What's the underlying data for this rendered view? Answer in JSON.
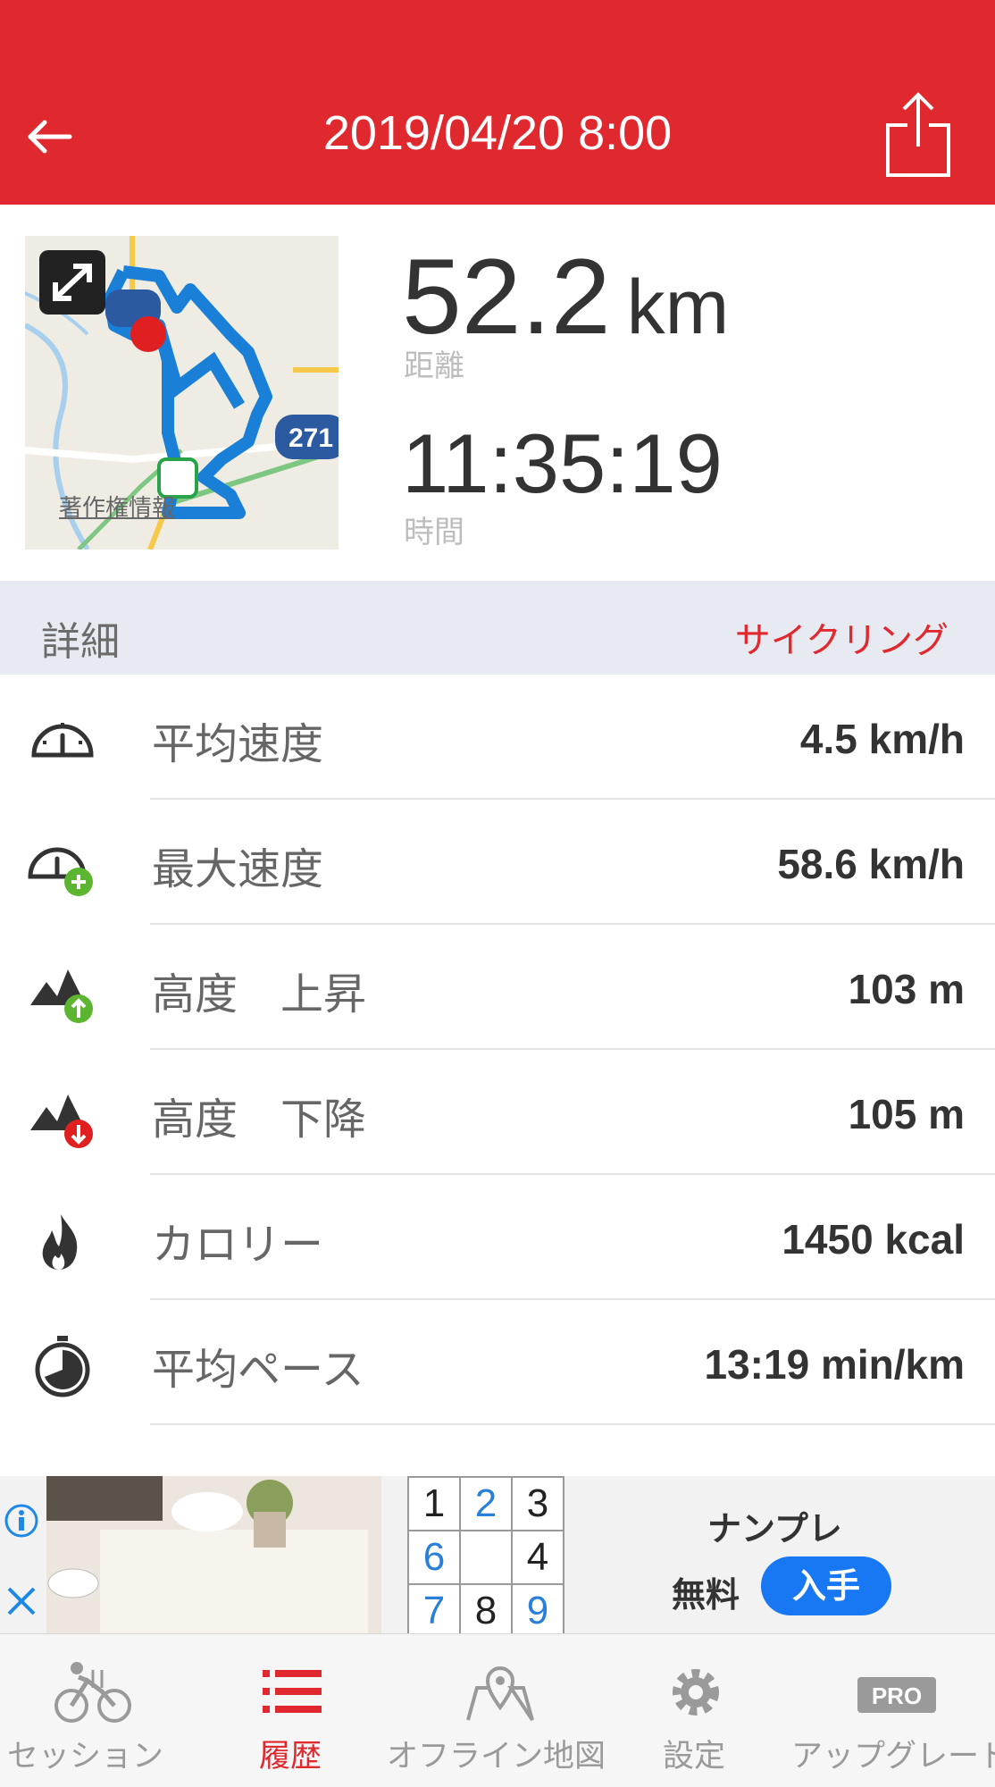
{
  "header": {
    "title": "2019/04/20 8:00",
    "color": "#e0292f"
  },
  "summary": {
    "distance_value": "52.2",
    "distance_unit": "km",
    "distance_label": "距離",
    "time_value": "11:35:19",
    "time_label": "時間",
    "map_copyright": "著作権情報",
    "map_road_label": "271"
  },
  "details": {
    "header_label": "詳細",
    "activity_type": "サイクリング",
    "rows": [
      {
        "icon": "speedometer-icon",
        "label": "平均速度",
        "value": "4.5 km/h"
      },
      {
        "icon": "speedometer-plus-icon",
        "label": "最大速度",
        "value": "58.6 km/h"
      },
      {
        "icon": "mountain-up-icon",
        "label": "高度　上昇",
        "value": "103 m"
      },
      {
        "icon": "mountain-down-icon",
        "label": "高度　下降",
        "value": "105 m"
      },
      {
        "icon": "flame-icon",
        "label": "カロリー",
        "value": "1450 kcal"
      },
      {
        "icon": "stopwatch-icon",
        "label": "平均ペース",
        "value": "13:19 min/km"
      }
    ]
  },
  "ad": {
    "app_name": "ナンプレ",
    "price": "無料",
    "cta": "入手",
    "grid": [
      "1",
      "2",
      "3",
      "6",
      "",
      "4",
      "7",
      "8",
      "9"
    ]
  },
  "tabbar": {
    "tabs": [
      {
        "icon": "cyclist-icon",
        "label": "セッション"
      },
      {
        "icon": "list-icon",
        "label": "履歴",
        "active": true
      },
      {
        "icon": "map-pin-icon",
        "label": "オフライン地図"
      },
      {
        "icon": "gear-icon",
        "label": "設定"
      },
      {
        "icon": "pro-badge-icon",
        "label": "アップグレード",
        "badge": "PRO"
      }
    ]
  }
}
